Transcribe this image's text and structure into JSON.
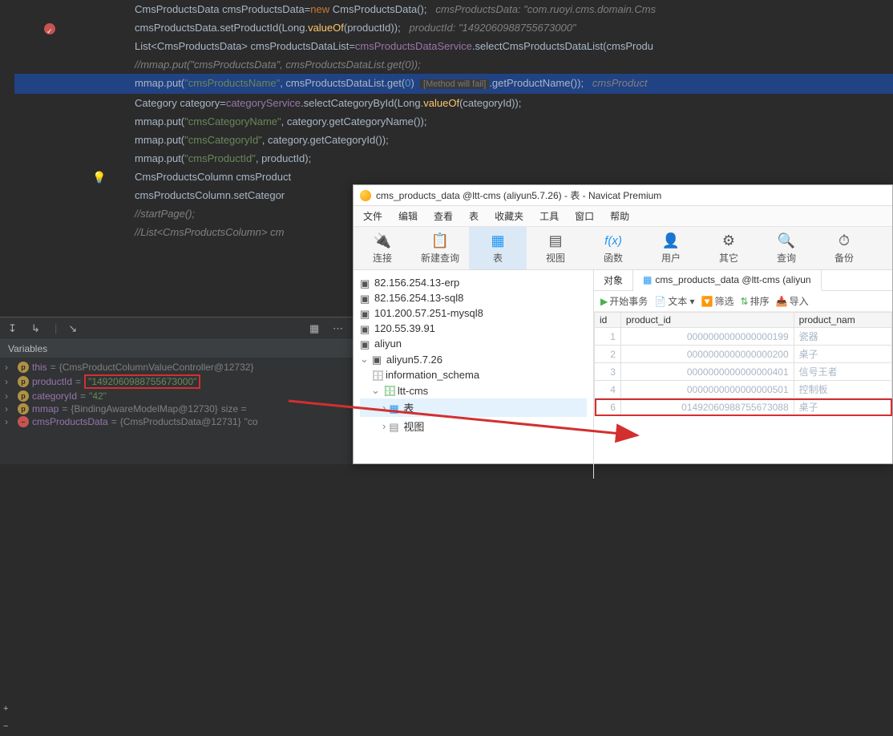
{
  "code": {
    "l1a": "CmsProductsData cmsProductsData=",
    "l1b": "new",
    "l1c": " CmsProductsData();   ",
    "l1cmt": "cmsProductsData: \"com.ruoyi.cms.domain.Cms",
    "l2a": "cmsProductsData.setProductId(Long.",
    "l2b": "valueOf",
    "l2c": "(productId));   ",
    "l2cmt": "productId: \"1492060988755673000\"",
    "l3a": "List<CmsProductsData> cmsProductsDataList=",
    "l3b": "cmsProductsDataService",
    "l3c": ".selectCmsProductsDataList(cmsProdu",
    "l4": "//mmap.put(\"cmsProductsData\", cmsProductsDataList.get(0));",
    "l5a": "mmap.put(",
    "l5b": "\"cmsProductsName\"",
    "l5c": ", cmsProductsDataList.get(",
    "l5d": "0",
    "l5e": ")  ",
    "l5hint": "[Method will fail]",
    "l5f": ".getProductName());   ",
    "l5cmt": "cmsProduct",
    "l6a": "Category category=",
    "l6b": "categoryService",
    "l6c": ".selectCategoryById(Long.",
    "l6d": "valueOf",
    "l6e": "(categoryId));",
    "l7a": "mmap.put(",
    "l7b": "\"cmsCategoryName\"",
    "l7c": ", category.getCategoryName());",
    "l8a": "mmap.put(",
    "l8b": "\"cmsCategoryId\"",
    "l8c": ", category.getCategoryId());",
    "l9a": "mmap.put(",
    "l9b": "\"cmsProductId\"",
    "l9c": ", productId);",
    "l10": "",
    "l11": "CmsProductsColumn cmsProduct",
    "l12": "cmsProductsColumn.setCategor",
    "l13": "//startPage();",
    "l14": "//List<CmsProductsColumn> cm"
  },
  "debug": {
    "variablesTitle": "Variables",
    "rows": [
      {
        "pill": "p",
        "pillCls": "",
        "name": "this",
        "eq": " = ",
        "val": "{CmsProductColumnValueController@12732}"
      },
      {
        "pill": "p",
        "pillCls": "",
        "name": "productId",
        "eq": " = ",
        "val": "\"1492060988755673000\"",
        "hl": true
      },
      {
        "pill": "p",
        "pillCls": "",
        "name": "categoryId",
        "eq": " = ",
        "val": "\"42\""
      },
      {
        "pill": "p",
        "pillCls": "",
        "name": "mmap",
        "eq": " = ",
        "val": "{BindingAwareModelMap@12730}",
        "extra": " size = "
      },
      {
        "pill": "–",
        "pillCls": "red",
        "name": "cmsProductsData",
        "eq": " = ",
        "val": "{CmsProductsData@12731}",
        "extra": " \"co"
      }
    ]
  },
  "navicat": {
    "title": "cms_products_data @ltt-cms (aliyun5.7.26) - 表 - Navicat Premium",
    "menu": [
      "文件",
      "编辑",
      "查看",
      "表",
      "收藏夹",
      "工具",
      "窗口",
      "帮助"
    ],
    "toolbar": [
      {
        "label": "连接",
        "ico": "🔌"
      },
      {
        "label": "新建查询",
        "ico": "📋"
      },
      {
        "label": "表",
        "ico": "▦",
        "active": true
      },
      {
        "label": "视图",
        "ico": "▤"
      },
      {
        "label": "函数",
        "ico": "f(x)"
      },
      {
        "label": "用户",
        "ico": "👤"
      },
      {
        "label": "其它",
        "ico": "⚙"
      },
      {
        "label": "查询",
        "ico": "🔍"
      },
      {
        "label": "备份",
        "ico": "⏱"
      }
    ],
    "tree": {
      "servers": [
        "82.156.254.13-erp",
        "82.156.254.13-sql8",
        "101.200.57.251-mysql8",
        "120.55.39.91",
        "aliyun"
      ],
      "openServer": "aliyun5.7.26",
      "dbInfo": "information_schema",
      "dbActive": "ltt-cms",
      "tableNode": "表",
      "viewNode": "视图"
    },
    "tabs": {
      "tab1": "对象",
      "tab2": "cms_products_data @ltt-cms (aliyun"
    },
    "subToolbar": [
      "开始事务",
      "文本 ▾",
      "筛选",
      "排序",
      "导入"
    ],
    "table": {
      "headers": [
        "id",
        "product_id",
        "product_nam"
      ],
      "rows": [
        [
          "1",
          "0000000000000000199",
          "瓷器"
        ],
        [
          "2",
          "0000000000000000200",
          "桌子"
        ],
        [
          "3",
          "0000000000000000401",
          "信号王者"
        ],
        [
          "4",
          "0000000000000000501",
          "控制板"
        ],
        [
          "6",
          "01492060988755673088",
          "桌子"
        ]
      ]
    }
  }
}
